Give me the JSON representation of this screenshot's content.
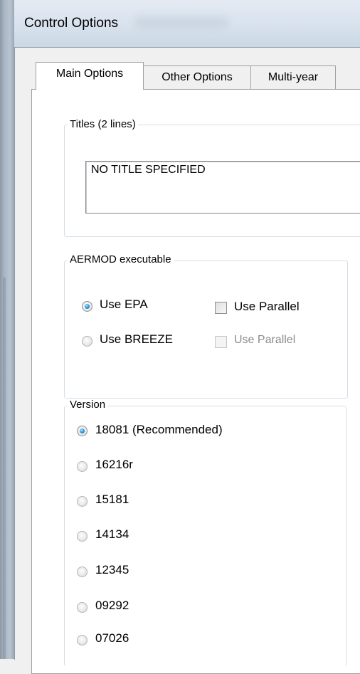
{
  "window": {
    "title": "Control Options"
  },
  "tabs": [
    {
      "label": "Main Options",
      "active": true
    },
    {
      "label": "Other Options",
      "active": false
    },
    {
      "label": "Multi-year",
      "active": false
    }
  ],
  "titles_group": {
    "legend": "Titles (2 lines)",
    "value": "NO TITLE SPECIFIED"
  },
  "executable_group": {
    "legend": "AERMOD executable",
    "options": [
      {
        "label": "Use EPA",
        "checked": true,
        "parallel_label": "Use Parallel",
        "parallel_checked": false,
        "parallel_enabled": true
      },
      {
        "label": "Use BREEZE",
        "checked": false,
        "parallel_label": "Use Parallel",
        "parallel_checked": false,
        "parallel_enabled": false
      }
    ]
  },
  "version_group": {
    "legend": "Version",
    "options": [
      {
        "label": "18081 (Recommended)",
        "checked": true
      },
      {
        "label": "16216r",
        "checked": false
      },
      {
        "label": "15181",
        "checked": false
      },
      {
        "label": "14134",
        "checked": false
      },
      {
        "label": "12345",
        "checked": false
      },
      {
        "label": "09292",
        "checked": false
      },
      {
        "label": "07026",
        "checked": false
      }
    ]
  }
}
